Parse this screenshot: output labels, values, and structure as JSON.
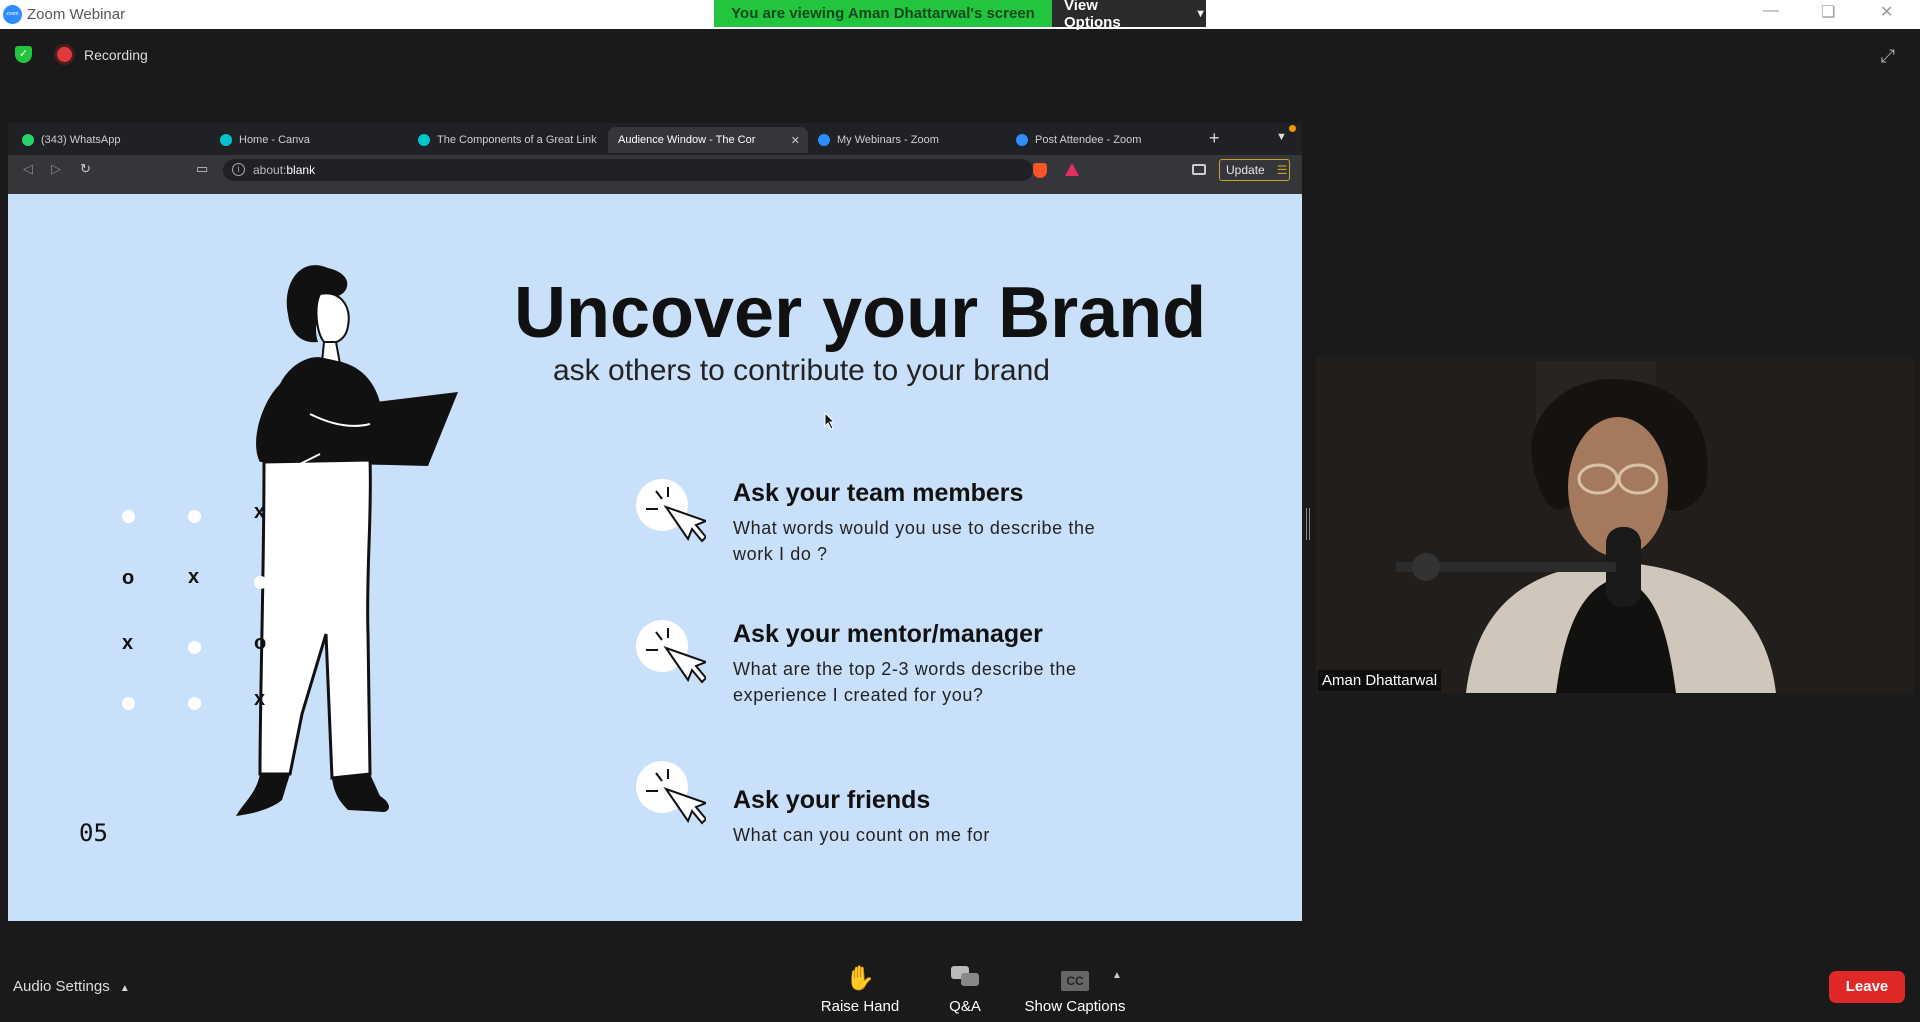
{
  "window": {
    "title": "Zoom Webinar",
    "icon_label": "zoom"
  },
  "banner": {
    "viewing_text": "You are viewing Aman Dhattarwal's screen",
    "view_options_label": "View Options"
  },
  "recording": {
    "label": "Recording"
  },
  "browser": {
    "tabs": [
      {
        "label": "(343) WhatsApp",
        "icon": "whatsapp-icon",
        "color": "#25d366"
      },
      {
        "label": "Home - Canva",
        "icon": "canva-icon",
        "color": "#00c4cc"
      },
      {
        "label": "The Components of a Great Link",
        "icon": "canva-icon",
        "color": "#00c4cc"
      },
      {
        "label": "Audience Window - The Cor",
        "icon": "",
        "color": "",
        "active": true
      },
      {
        "label": "My Webinars - Zoom",
        "icon": "zoom-icon",
        "color": "#2d8cff"
      },
      {
        "label": "Post Attendee - Zoom",
        "icon": "zoom-icon",
        "color": "#2d8cff"
      }
    ],
    "url_prefix": "about:",
    "url_highlight": "blank",
    "update_label": "Update"
  },
  "slide": {
    "title": "Uncover your Brand",
    "subtitle": "ask others to contribute to your brand",
    "items": [
      {
        "heading": "Ask your team members",
        "body_line1": "What words would you use to describe the",
        "body_line2": "work I do ?"
      },
      {
        "heading": "Ask your mentor/manager",
        "body_line1": "What are the top 2-3 words describe the",
        "body_line2": "experience I created for you?"
      },
      {
        "heading": "Ask your friends",
        "body_line1": "What can you count on me for",
        "body_line2": ""
      }
    ],
    "page_number": "05",
    "grid_symbols": [
      "x",
      "o",
      "x",
      "x",
      "o",
      "x"
    ],
    "background_color": "#c8e0fa"
  },
  "video": {
    "participant_name": "Aman Dhattarwal"
  },
  "toolbar": {
    "audio_settings_label": "Audio Settings",
    "raise_hand_label": "Raise Hand",
    "qa_label": "Q&A",
    "captions_label": "Show Captions",
    "cc_label": "CC",
    "leave_label": "Leave"
  },
  "colors": {
    "banner_green": "#23c53f",
    "leave_red": "#e02828",
    "recording_red": "#e0393e"
  }
}
